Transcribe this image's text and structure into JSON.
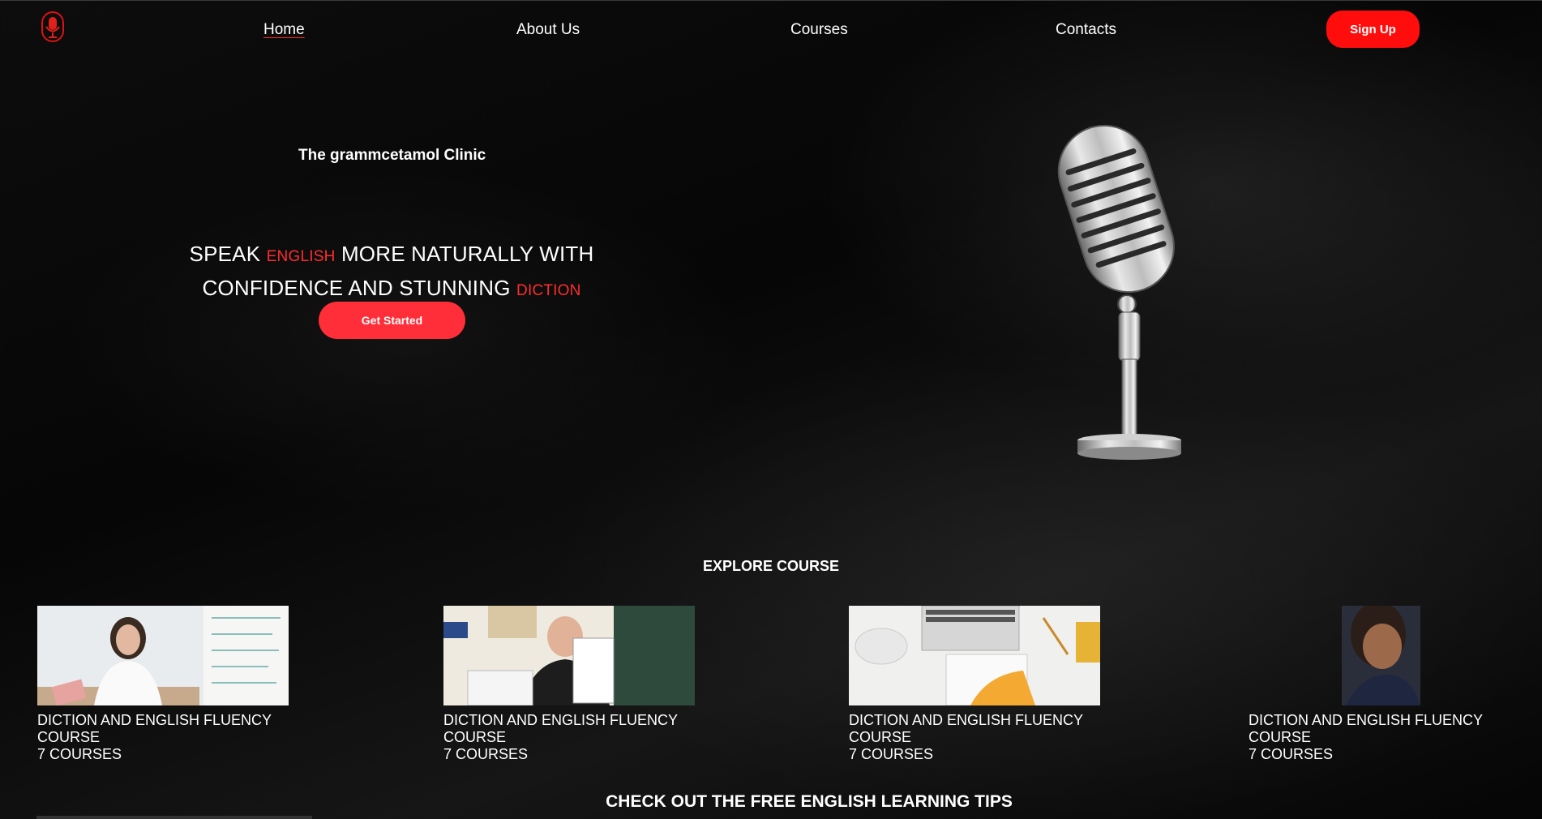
{
  "nav": {
    "links": [
      "Home",
      "About Us",
      "Courses",
      "Contacts"
    ],
    "signup_label": "Sign Up",
    "logo_icon": "microphone-logo-icon",
    "accent_color": "#ff0d0d"
  },
  "hero": {
    "brand": "The grammcetamol Clinic",
    "headline": {
      "p1": "SPEAK ",
      "a1": "ENGLISH",
      "p2": " MORE NATURALLY WITH",
      "p3": "CONFIDENCE AND STUNNING ",
      "a2": "DICTION"
    },
    "cta_label": "Get Started",
    "image_icon": "microphone-icon"
  },
  "explore": {
    "title": "EXPLORE COURSE",
    "cards": [
      {
        "line1": "DICTION AND ENGLISH FLUENCY",
        "line2": "COURSE",
        "count": "7 COURSES"
      },
      {
        "line1": "DICTION AND ENGLISH FLUENCY",
        "line2": "COURSE",
        "count": "7 COURSES"
      },
      {
        "line1": "DICTION AND ENGLISH FLUENCY",
        "line2": "COURSE",
        "count": "7 COURSES"
      },
      {
        "line1": "DICTION AND ENGLISH FLUENCY",
        "line2": "COURSE",
        "count": "7 COURSES"
      }
    ]
  },
  "tips": {
    "title": "CHECK OUT THE FREE ENGLISH LEARNING TIPS"
  }
}
